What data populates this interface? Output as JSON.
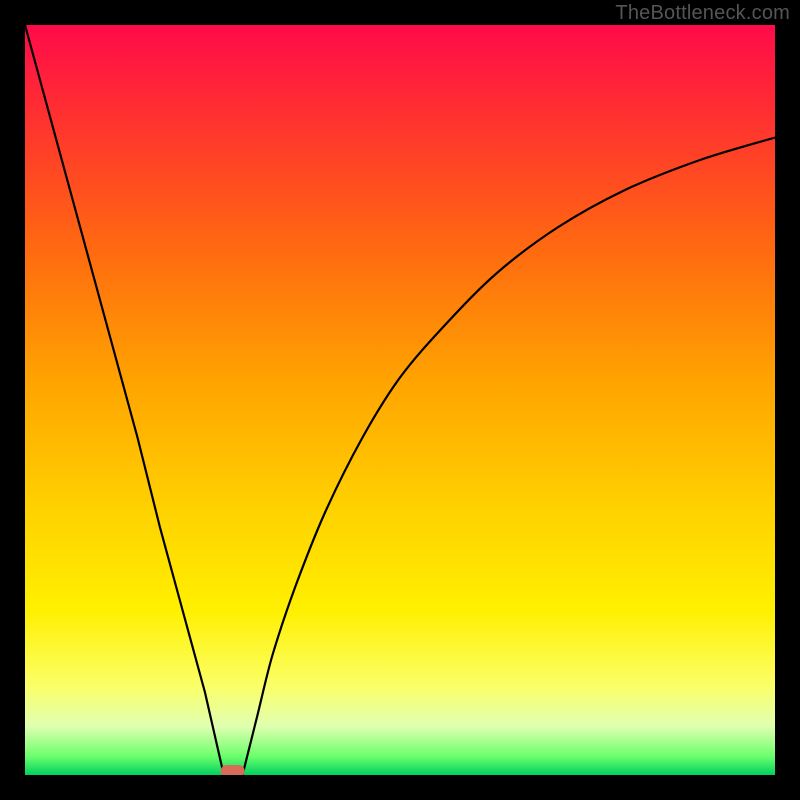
{
  "attribution": "TheBottleneck.com",
  "chart_data": {
    "type": "line",
    "title": "",
    "xlabel": "",
    "ylabel": "",
    "xlim": [
      0,
      100
    ],
    "ylim": [
      0,
      100
    ],
    "background_gradient_colors": [
      "#ff0a4a",
      "#ff3030",
      "#ff6a10",
      "#ffa500",
      "#ffd000",
      "#fff000",
      "#fbff66",
      "#e0ffb0",
      "#6cff6c",
      "#00d060"
    ],
    "series": [
      {
        "name": "left-branch",
        "x": [
          0,
          3,
          6,
          9,
          12,
          15,
          18,
          21,
          24,
          26.5
        ],
        "y": [
          100,
          89,
          78,
          67,
          56,
          45,
          33,
          22,
          11,
          0
        ]
      },
      {
        "name": "right-branch",
        "x": [
          29,
          31,
          33,
          36,
          40,
          45,
          50,
          56,
          63,
          71,
          80,
          90,
          100
        ],
        "y": [
          0,
          8,
          16,
          25,
          35,
          45,
          53,
          60,
          67,
          73,
          78,
          82,
          85
        ]
      }
    ],
    "marker": {
      "name": "bottom-marker",
      "x_center": 27.7,
      "y": 0,
      "color": "#d86a5a",
      "width_pct": 3.2
    }
  }
}
